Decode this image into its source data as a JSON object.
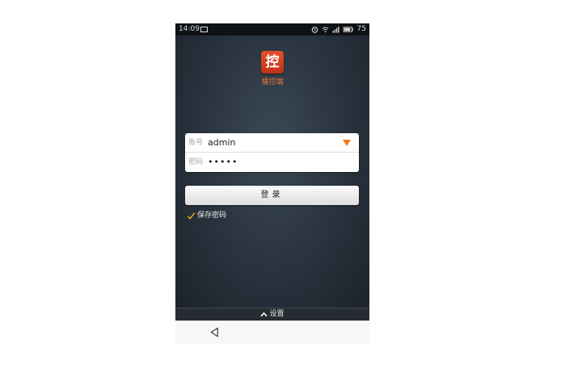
{
  "status_bar": {
    "time": "14:09",
    "battery": "75",
    "icons": [
      "image-icon",
      "alarm-icon",
      "wifi-icon",
      "signal-icon",
      "battery-icon"
    ]
  },
  "app": {
    "logo_char": "控",
    "logo_caption": "播控端",
    "logo_color": "#d8401f",
    "caption_color": "#e2773a"
  },
  "login_form": {
    "account_label": "账号",
    "account_value": "admin",
    "password_label": "密码",
    "password_value": "•••••",
    "dropdown_color": "#f07a1a"
  },
  "login_button": {
    "label": "登录"
  },
  "remember": {
    "label": "保存密码",
    "checked": true,
    "check_color": "#f0b400"
  },
  "settings_bar": {
    "label": "设置",
    "icon": "chevron-up-icon"
  },
  "nav_bar": {
    "icon": "back-icon"
  }
}
